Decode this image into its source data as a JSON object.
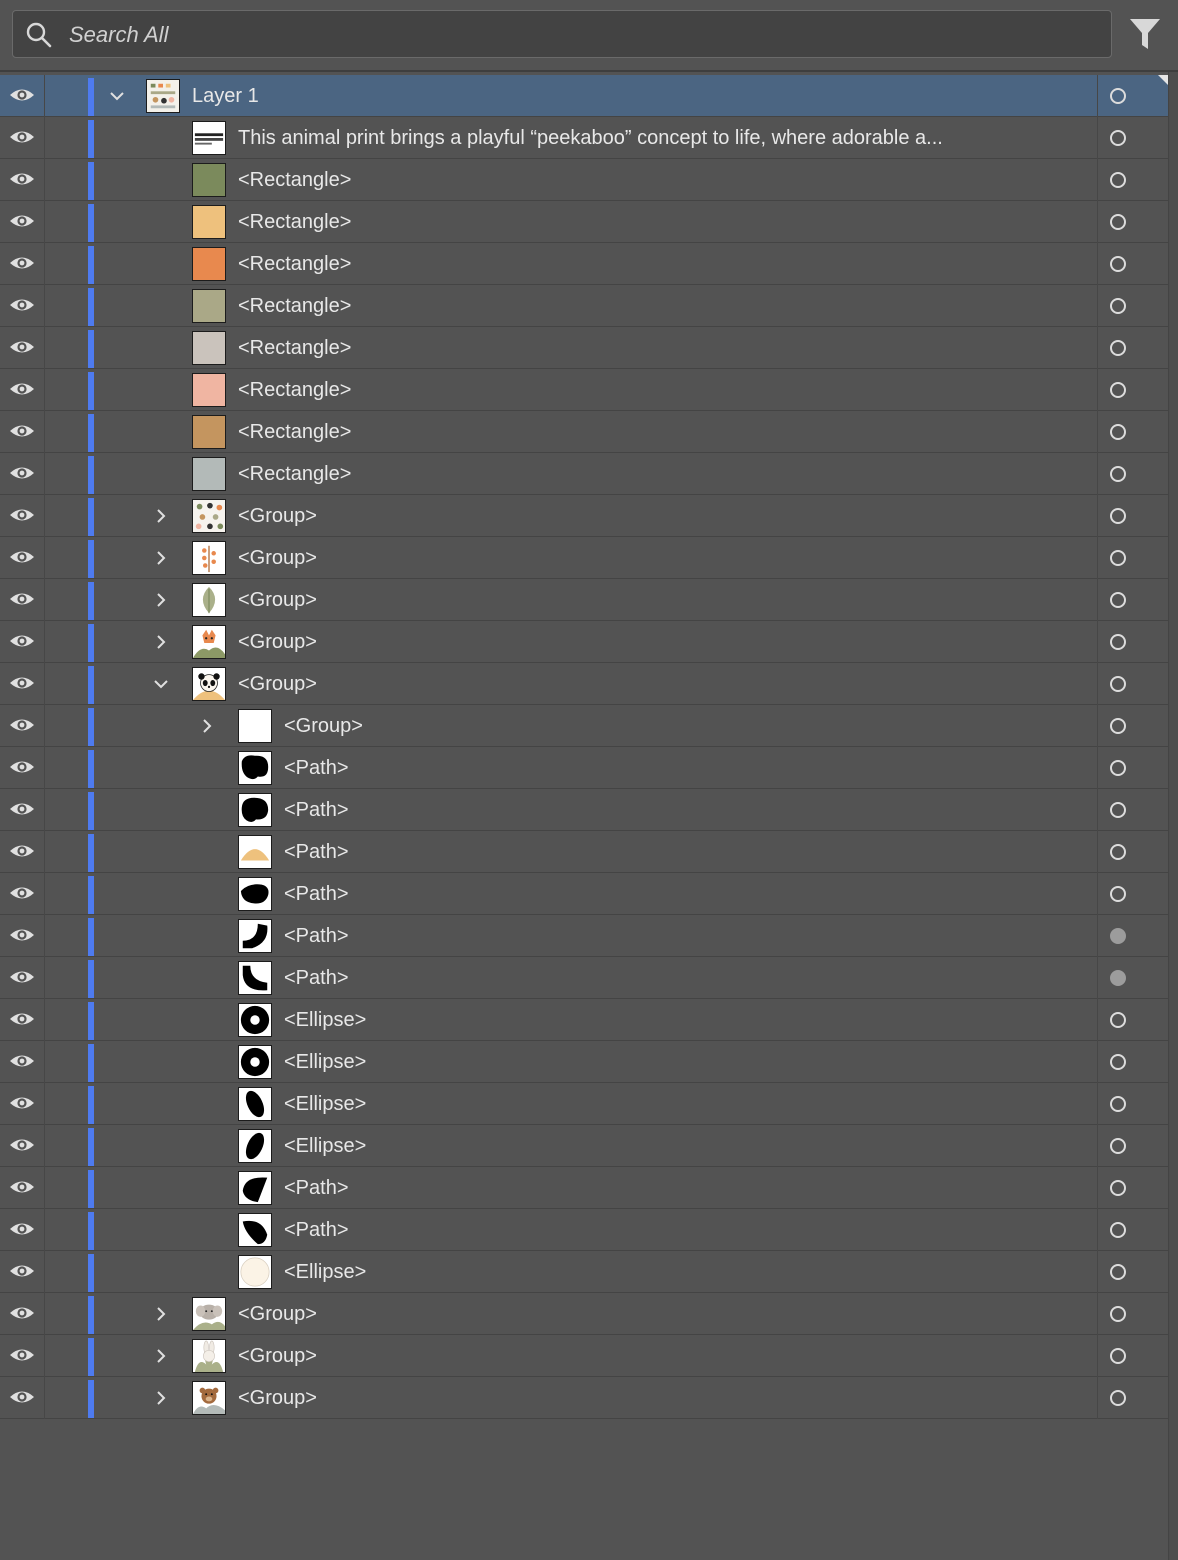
{
  "search": {
    "placeholder": "Search All"
  },
  "colors": {
    "panel_bg": "#535353",
    "selected_row": "#4b6582",
    "layer_color_bar": "#4e7bf0"
  },
  "layers": [
    {
      "label": "Layer 1",
      "indent": 0,
      "disclosure": "expanded",
      "thumb": "layer-overview",
      "selected": true,
      "target_filled": false
    },
    {
      "label": "This animal print brings a playful “peekaboo” concept to life, where adorable  a...",
      "indent": 1,
      "disclosure": "none",
      "thumb": "text-block",
      "selected": false,
      "target_filled": false
    },
    {
      "label": "<Rectangle>",
      "indent": 1,
      "disclosure": "none",
      "thumb": "swatch",
      "swatch": "#7b8a5c",
      "selected": false,
      "target_filled": false
    },
    {
      "label": "<Rectangle>",
      "indent": 1,
      "disclosure": "none",
      "thumb": "swatch",
      "swatch": "#eec17d",
      "selected": false,
      "target_filled": false
    },
    {
      "label": "<Rectangle>",
      "indent": 1,
      "disclosure": "none",
      "thumb": "swatch",
      "swatch": "#e8894e",
      "selected": false,
      "target_filled": false
    },
    {
      "label": "<Rectangle>",
      "indent": 1,
      "disclosure": "none",
      "thumb": "swatch",
      "swatch": "#aaa887",
      "selected": false,
      "target_filled": false
    },
    {
      "label": "<Rectangle>",
      "indent": 1,
      "disclosure": "none",
      "thumb": "swatch",
      "swatch": "#cac3bc",
      "selected": false,
      "target_filled": false
    },
    {
      "label": "<Rectangle>",
      "indent": 1,
      "disclosure": "none",
      "thumb": "swatch",
      "swatch": "#f0b5a2",
      "selected": false,
      "target_filled": false
    },
    {
      "label": "<Rectangle>",
      "indent": 1,
      "disclosure": "none",
      "thumb": "swatch",
      "swatch": "#c4955f",
      "selected": false,
      "target_filled": false
    },
    {
      "label": "<Rectangle>",
      "indent": 1,
      "disclosure": "none",
      "thumb": "swatch",
      "swatch": "#b3bab8",
      "selected": false,
      "target_filled": false
    },
    {
      "label": "<Group>",
      "indent": 1,
      "disclosure": "collapsed",
      "thumb": "pattern",
      "selected": false,
      "target_filled": false
    },
    {
      "label": "<Group>",
      "indent": 1,
      "disclosure": "collapsed",
      "thumb": "berries",
      "selected": false,
      "target_filled": false
    },
    {
      "label": "<Group>",
      "indent": 1,
      "disclosure": "collapsed",
      "thumb": "leaf",
      "selected": false,
      "target_filled": false
    },
    {
      "label": "<Group>",
      "indent": 1,
      "disclosure": "collapsed",
      "thumb": "fox",
      "selected": false,
      "target_filled": false
    },
    {
      "label": "<Group>",
      "indent": 1,
      "disclosure": "expanded",
      "thumb": "panda",
      "selected": false,
      "target_filled": false
    },
    {
      "label": "<Group>",
      "indent": 2,
      "disclosure": "collapsed",
      "thumb": "blank",
      "selected": false,
      "target_filled": false
    },
    {
      "label": "<Path>",
      "indent": 2,
      "disclosure": "none",
      "thumb": "blob-a",
      "selected": false,
      "target_filled": false
    },
    {
      "label": "<Path>",
      "indent": 2,
      "disclosure": "none",
      "thumb": "blob-b",
      "selected": false,
      "target_filled": false
    },
    {
      "label": "<Path>",
      "indent": 2,
      "disclosure": "none",
      "thumb": "half-dome",
      "selected": false,
      "target_filled": false
    },
    {
      "label": "<Path>",
      "indent": 2,
      "disclosure": "none",
      "thumb": "flat-blob",
      "selected": false,
      "target_filled": false
    },
    {
      "label": "<Path>",
      "indent": 2,
      "disclosure": "none",
      "thumb": "arm-right",
      "selected": false,
      "target_filled": true
    },
    {
      "label": "<Path>",
      "indent": 2,
      "disclosure": "none",
      "thumb": "arm-left",
      "selected": false,
      "target_filled": true
    },
    {
      "label": "<Ellipse>",
      "indent": 2,
      "disclosure": "none",
      "thumb": "ring",
      "selected": false,
      "target_filled": false
    },
    {
      "label": "<Ellipse>",
      "indent": 2,
      "disclosure": "none",
      "thumb": "ring",
      "selected": false,
      "target_filled": false
    },
    {
      "label": "<Ellipse>",
      "indent": 2,
      "disclosure": "none",
      "thumb": "oval-left",
      "selected": false,
      "target_filled": false
    },
    {
      "label": "<Ellipse>",
      "indent": 2,
      "disclosure": "none",
      "thumb": "oval-right",
      "selected": false,
      "target_filled": false
    },
    {
      "label": "<Path>",
      "indent": 2,
      "disclosure": "none",
      "thumb": "ear-a",
      "selected": false,
      "target_filled": false
    },
    {
      "label": "<Path>",
      "indent": 2,
      "disclosure": "none",
      "thumb": "ear-b",
      "selected": false,
      "target_filled": false
    },
    {
      "label": "<Ellipse>",
      "indent": 2,
      "disclosure": "none",
      "thumb": "cream-circle",
      "selected": false,
      "target_filled": false
    },
    {
      "label": "<Group>",
      "indent": 1,
      "disclosure": "collapsed",
      "thumb": "elephant",
      "selected": false,
      "target_filled": false
    },
    {
      "label": "<Group>",
      "indent": 1,
      "disclosure": "collapsed",
      "thumb": "bunny",
      "selected": false,
      "target_filled": false
    },
    {
      "label": "<Group>",
      "indent": 1,
      "disclosure": "collapsed",
      "thumb": "bear",
      "selected": false,
      "target_filled": false
    }
  ]
}
